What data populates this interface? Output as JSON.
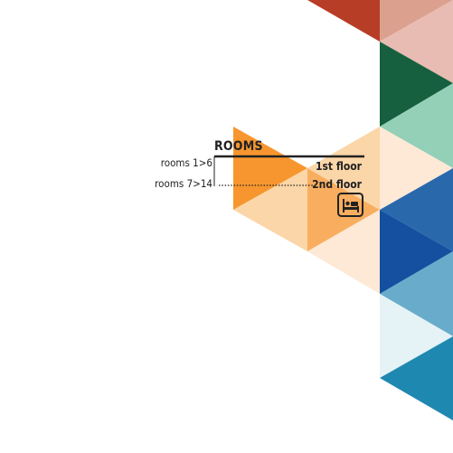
{
  "directory": {
    "title": "ROOMS",
    "rows": [
      {
        "rooms": "rooms 1>6",
        "floor": "1st floor",
        "leader": "solid"
      },
      {
        "rooms": "rooms 7>14",
        "floor": "2nd floor",
        "leader": "dotted"
      }
    ],
    "icon": "bed-icon"
  },
  "colors": {
    "text": "#222222",
    "orange": "#f7962e",
    "orange_mid": "#f9ae5f",
    "orange_light": "#fbd6a8",
    "orange_pale": "#fde9d6",
    "red": "#b83d27",
    "red_light": "#dca08f",
    "red_pale": "#e9bcb3",
    "green_dark": "#17603f",
    "green_light": "#94d0b8",
    "blue_mid": "#2a68ac",
    "blue_dark": "#14509f",
    "blue_light": "#69abca",
    "blue_pale": "#e5f3f6",
    "teal": "#1f88b1"
  }
}
